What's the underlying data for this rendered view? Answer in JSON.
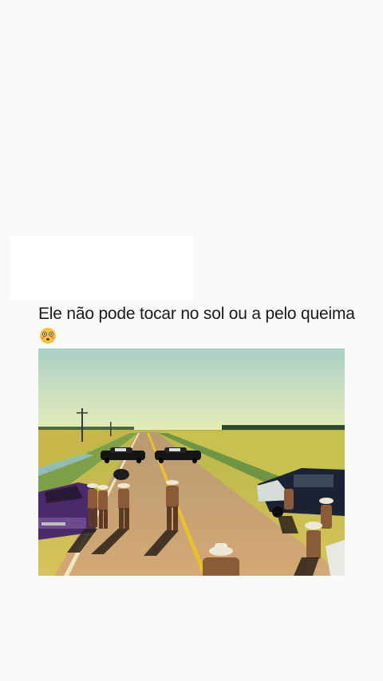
{
  "post": {
    "caption_text": "Ele não pode tocar no sol ou a pelo queima",
    "caption_emoji": "flushed-face-emoji"
  },
  "colors": {
    "background": "#fafafa",
    "caption_text": "#1a1a1a",
    "sky": "#b9d8d0",
    "field": "#c9c04a",
    "road": "#c7a26a"
  },
  "photo": {
    "subject": "police-roadblock-scene"
  }
}
